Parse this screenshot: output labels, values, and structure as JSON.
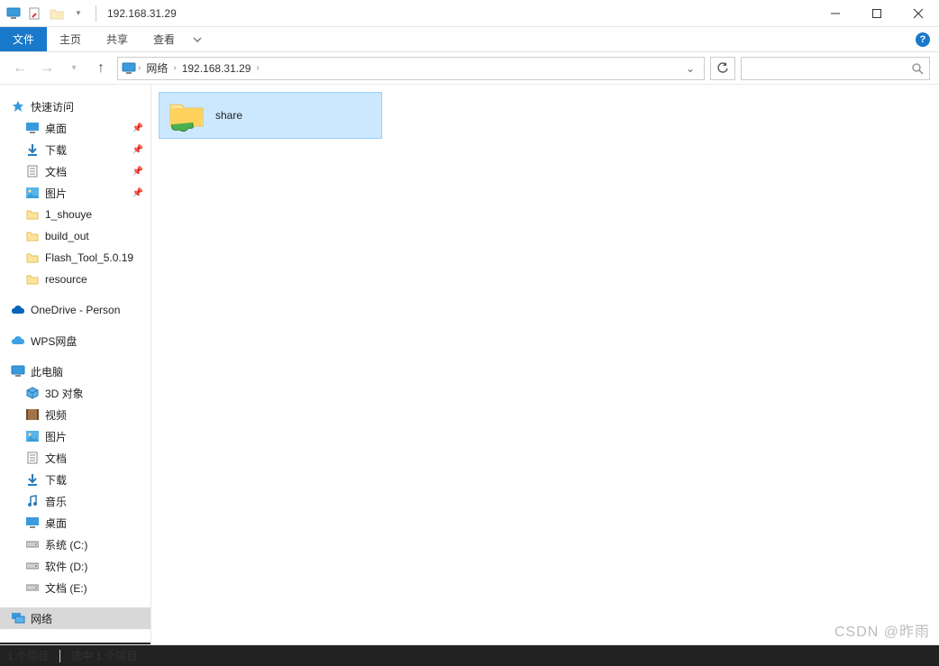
{
  "titlebar": {
    "title": "192.168.31.29"
  },
  "ribbon": {
    "file": "文件",
    "home": "主页",
    "share": "共享",
    "view": "查看"
  },
  "navbar": {
    "breadcrumb": [
      "网络",
      "192.168.31.29"
    ],
    "search_icon": "search"
  },
  "sidebar": {
    "quick_access": "快速访问",
    "quick_items": [
      {
        "label": "桌面",
        "pinned": true,
        "icon": "desktop"
      },
      {
        "label": "下载",
        "pinned": true,
        "icon": "download"
      },
      {
        "label": "文档",
        "pinned": true,
        "icon": "document"
      },
      {
        "label": "图片",
        "pinned": true,
        "icon": "pictures"
      },
      {
        "label": "1_shouye",
        "pinned": false,
        "icon": "folder"
      },
      {
        "label": "build_out",
        "pinned": false,
        "icon": "folder"
      },
      {
        "label": "Flash_Tool_5.0.19",
        "pinned": false,
        "icon": "folder"
      },
      {
        "label": "resource",
        "pinned": false,
        "icon": "folder"
      }
    ],
    "onedrive": "OneDrive - Person",
    "wps": "WPS网盘",
    "this_pc": "此电脑",
    "pc_items": [
      {
        "label": "3D 对象",
        "icon": "3d"
      },
      {
        "label": "视频",
        "icon": "video"
      },
      {
        "label": "图片",
        "icon": "pictures"
      },
      {
        "label": "文档",
        "icon": "document"
      },
      {
        "label": "下载",
        "icon": "download"
      },
      {
        "label": "音乐",
        "icon": "music"
      },
      {
        "label": "桌面",
        "icon": "desktop"
      },
      {
        "label": "系统 (C:)",
        "icon": "drive"
      },
      {
        "label": "软件 (D:)",
        "icon": "drive"
      },
      {
        "label": "文档 (E:)",
        "icon": "drive"
      }
    ],
    "network": "网络"
  },
  "content": {
    "items": [
      {
        "name": "share"
      }
    ]
  },
  "statusbar": {
    "count": "1 个项目",
    "selected": "选中 1 个项目"
  },
  "watermark": "CSDN @昨雨"
}
